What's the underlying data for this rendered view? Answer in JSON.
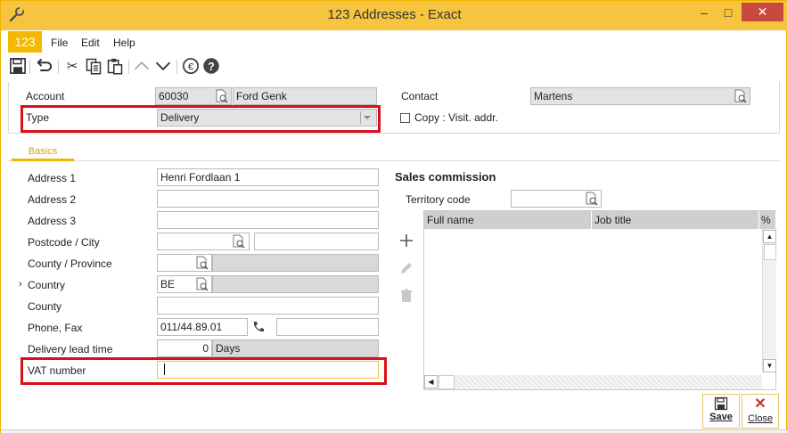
{
  "window": {
    "title": "123 Addresses - Exact",
    "minimize": "–",
    "maximize": "□",
    "close": "✕"
  },
  "menu": {
    "logo": "123",
    "file": "File",
    "edit": "Edit",
    "help": "Help"
  },
  "header": {
    "account_label": "Account",
    "account_code": "60030",
    "account_name": "Ford Genk",
    "type_label": "Type",
    "type_value": "Delivery",
    "contact_label": "Contact",
    "contact_value": "Martens",
    "copy_label": "Copy : Visit. addr."
  },
  "tabs": {
    "basics": "Basics"
  },
  "address": {
    "address1_label": "Address 1",
    "address1_value": "Henri Fordlaan 1",
    "address2_label": "Address 2",
    "address3_label": "Address 3",
    "postcode_city_label": "Postcode / City",
    "county_province_label": "County / Province",
    "country_label": "Country",
    "country_value": "BE",
    "county_label": "County",
    "phone_fax_label": "Phone, Fax",
    "phone_value": "011/44.89.01",
    "lead_time_label": "Delivery lead time",
    "lead_time_value": "0",
    "lead_time_unit": "Days",
    "vat_label": "VAT number"
  },
  "sales": {
    "title": "Sales commission",
    "territory_label": "Territory code",
    "columns": [
      "Full name",
      "Job title",
      "%"
    ]
  },
  "actions": {
    "save": "Save",
    "close": "Close"
  },
  "colors": {
    "accent": "#f5b800",
    "titlebar": "#f7c43f",
    "highlight": "#d9101a"
  }
}
